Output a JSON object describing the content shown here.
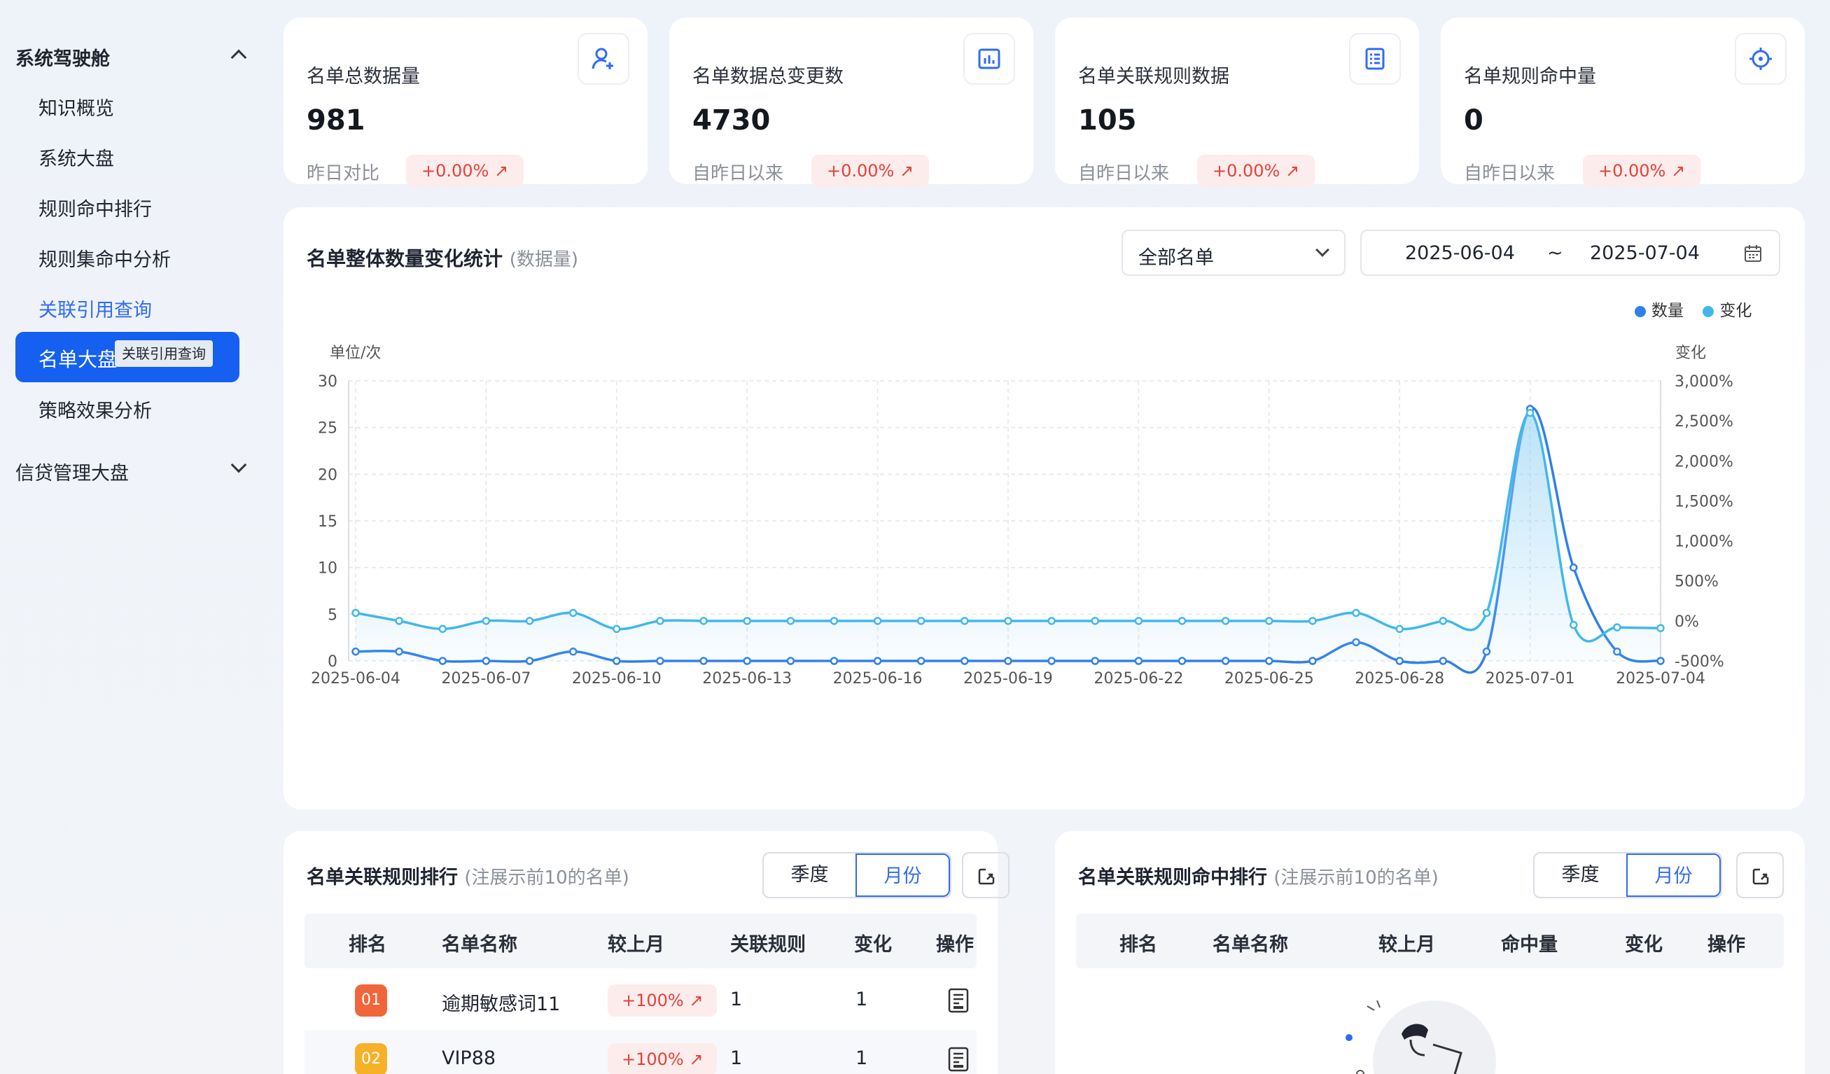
{
  "sidebar": {
    "group1": "系统驾驶舱",
    "items": [
      "知识概览",
      "系统大盘",
      "规则命中排行",
      "规则集命中分析",
      "关联引用查询",
      "名单大盘",
      "策略效果分析"
    ],
    "active_tooltip": "关联引用查询",
    "group2": "信贷管理大盘"
  },
  "stats": [
    {
      "title": "名单总数据量",
      "value": "981",
      "sub": "昨日对比",
      "change": "+0.00% ↗",
      "icon": "user-add-icon"
    },
    {
      "title": "名单数据总变更数",
      "value": "4730",
      "sub": "自昨日以来",
      "change": "+0.00% ↗",
      "icon": "bar-chart-icon"
    },
    {
      "title": "名单关联规则数据",
      "value": "105",
      "sub": "自昨日以来",
      "change": "+0.00% ↗",
      "icon": "list-icon"
    },
    {
      "title": "名单规则命中量",
      "value": "0",
      "sub": "自昨日以来",
      "change": "+0.00% ↗",
      "icon": "target-icon"
    }
  ],
  "chart_card": {
    "title": "名单整体数量变化统计",
    "title_sub": "(数据量)",
    "select_value": "全部名单",
    "date_start": "2025-06-04",
    "date_sep": "~",
    "date_end": "2025-07-04"
  },
  "chart_data": {
    "type": "line",
    "ylabel_left": "单位/次",
    "ylabel_right": "变化",
    "left_ticks": [
      "0",
      "5",
      "10",
      "15",
      "20",
      "25",
      "30"
    ],
    "right_ticks": [
      "-500%",
      "0%",
      "500%",
      "1,000%",
      "1,500%",
      "2,000%",
      "2,500%",
      "3,000%"
    ],
    "ylim_left": [
      0,
      30
    ],
    "ylim_right": [
      -500,
      3000
    ],
    "x_tick_labels": [
      "2025-06-04",
      "2025-06-07",
      "2025-06-10",
      "2025-06-13",
      "2025-06-16",
      "2025-06-19",
      "2025-06-22",
      "2025-06-25",
      "2025-06-28",
      "2025-07-01",
      "2025-07-04"
    ],
    "x": [
      "06-04",
      "06-05",
      "06-06",
      "06-07",
      "06-08",
      "06-09",
      "06-10",
      "06-11",
      "06-12",
      "06-13",
      "06-14",
      "06-15",
      "06-16",
      "06-17",
      "06-18",
      "06-19",
      "06-20",
      "06-21",
      "06-22",
      "06-23",
      "06-24",
      "06-25",
      "06-26",
      "06-27",
      "06-28",
      "06-29",
      "06-30",
      "07-01",
      "07-02",
      "07-03",
      "07-04"
    ],
    "legend_position": "top-right",
    "grid": true,
    "series": [
      {
        "name": "数量",
        "axis": "left",
        "color": "#2f80e8",
        "values": [
          1,
          1,
          0,
          0,
          0,
          1,
          0,
          0,
          0,
          0,
          0,
          0,
          0,
          0,
          0,
          0,
          0,
          0,
          0,
          0,
          0,
          0,
          0,
          2,
          0,
          0,
          1,
          27,
          10,
          1,
          0
        ]
      },
      {
        "name": "变化",
        "axis": "right",
        "color": "#41b8ea",
        "values": [
          100,
          0,
          -100,
          0,
          0,
          100,
          -100,
          0,
          0,
          0,
          0,
          0,
          0,
          0,
          0,
          0,
          0,
          0,
          0,
          0,
          0,
          0,
          0,
          100,
          -100,
          0,
          100,
          2600,
          -50,
          -80,
          -90
        ]
      }
    ]
  },
  "panel_left": {
    "title": "名单关联规则排行",
    "title_sub": "(注展示前10的名单)",
    "seg": [
      "季度",
      "月份"
    ],
    "headers": [
      "排名",
      "名单名称",
      "较上月",
      "关联规则",
      "变化",
      "操作"
    ],
    "rows": [
      {
        "rank": "01",
        "name": "逾期敏感词11",
        "change": "+100% ↗",
        "rules": "1",
        "delta": "1",
        "rank_color": "#f0663a"
      },
      {
        "rank": "02",
        "name": "VIP88",
        "change": "+100% ↗",
        "rules": "1",
        "delta": "1",
        "rank_color": "#f6b128"
      }
    ]
  },
  "panel_right": {
    "title": "名单关联规则命中排行",
    "title_sub": "(注展示前10的名单)",
    "seg": [
      "季度",
      "月份"
    ],
    "headers": [
      "排名",
      "名单名称",
      "较上月",
      "命中量",
      "变化",
      "操作"
    ]
  }
}
